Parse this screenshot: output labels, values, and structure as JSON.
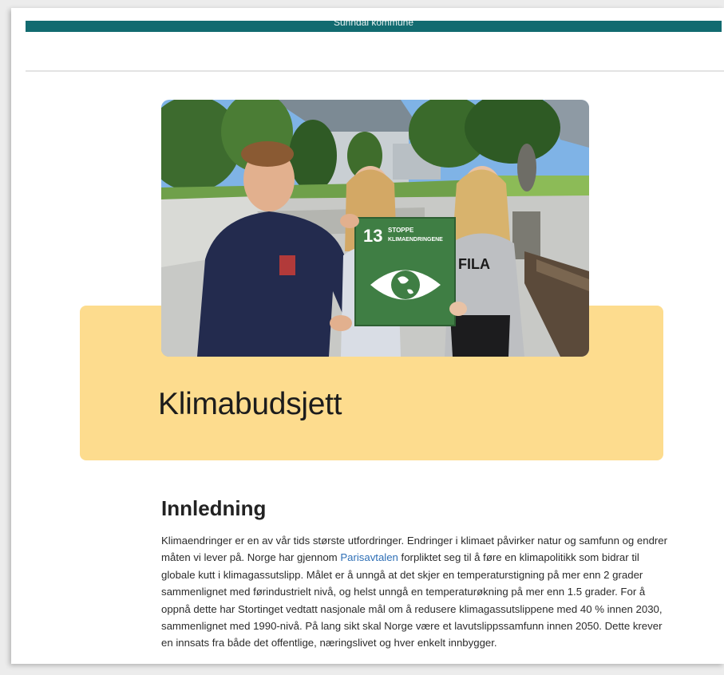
{
  "header": {
    "municipality_name": "Sunndal kommune"
  },
  "hero": {
    "sign_number": "13",
    "sign_text_line1": "STOPPE",
    "sign_text_line2": "KLIMAENDRINGENE",
    "shirt_text": "FILA"
  },
  "page": {
    "title": "Klimabudsjett"
  },
  "intro": {
    "heading": "Innledning",
    "text_before_link": "Klimaendringer er en av vår tids største utfordringer. Endringer i klimaet påvirker natur og samfunn og endrer måten vi lever på. Norge har gjennom ",
    "link_text": "Parisavtalen",
    "text_after_link": " forpliktet seg til å føre en klimapolitikk som bidrar til globale kutt i klimagassutslipp. Målet er å unngå at det skjer en temperaturstigning på mer enn 2 grader sammenlignet med førindustrielt nivå, og helst unngå en temperaturøkning på mer enn 1.5 grader. For å oppnå dette har Stortinget vedtatt nasjonale mål om å redusere klimagassutslippene med 40 % innen 2030, sammenlignet med 1990-nivå. På lang sikt skal Norge være et lavutslippssamfunn innen 2050. Dette krever en innsats fra både det offentlige, næringslivet og hver enkelt innbygger."
  },
  "colors": {
    "topbar": "#126b70",
    "banner": "#fddc8e",
    "link": "#2e6fb6",
    "sdg13_green": "#3f7e44"
  }
}
